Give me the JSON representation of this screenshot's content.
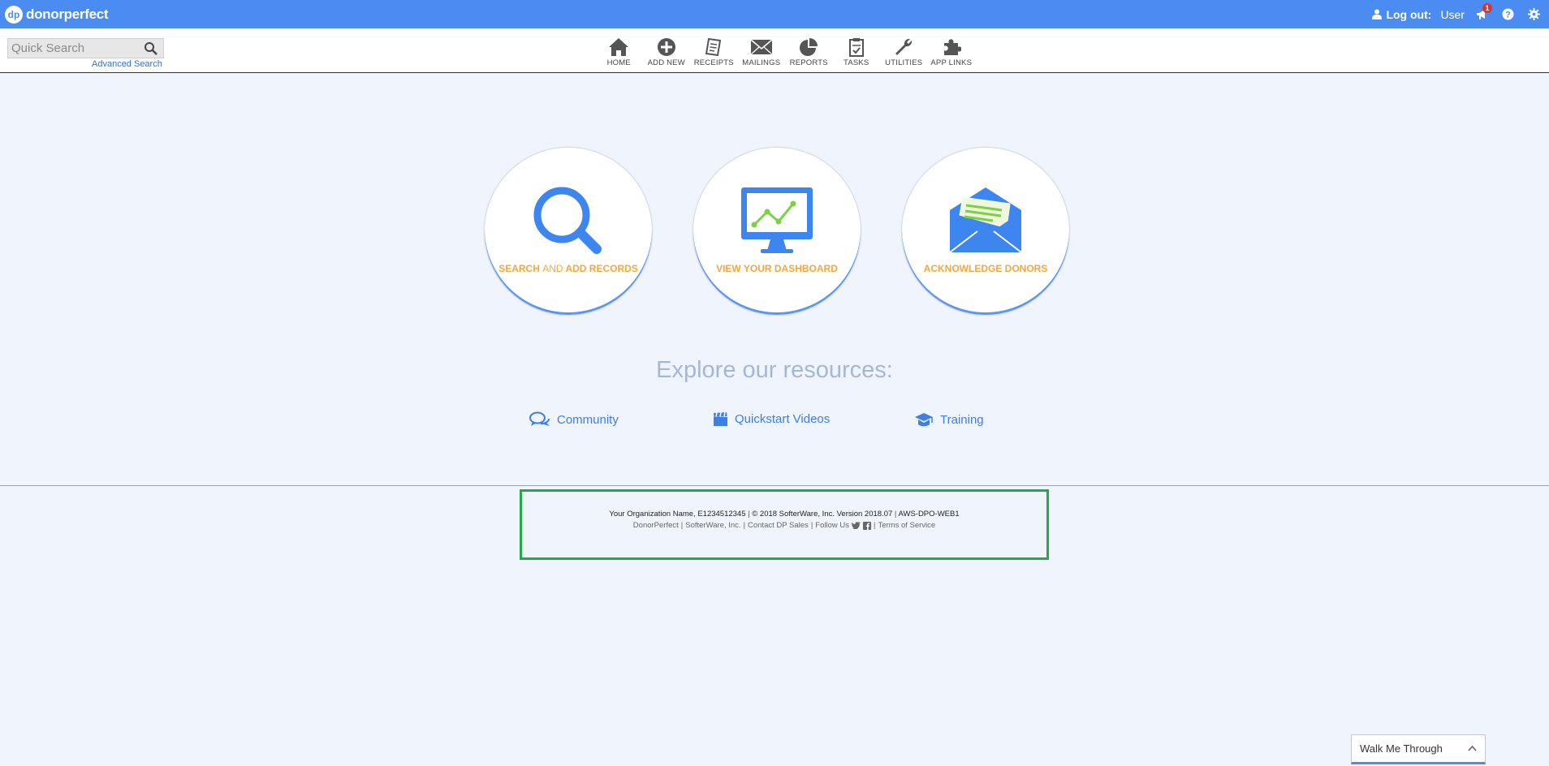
{
  "brand": {
    "badge": "dp",
    "name": "donorperfect"
  },
  "topbar": {
    "logout_label": "Log out:",
    "user": "User",
    "notification_count": "1"
  },
  "search": {
    "placeholder": "Quick Search",
    "advanced_label": "Advanced Search"
  },
  "nav": {
    "items": [
      {
        "label": "HOME",
        "icon": "home-icon"
      },
      {
        "label": "ADD NEW",
        "icon": "plus-circle-icon"
      },
      {
        "label": "RECEIPTS",
        "icon": "receipt-icon"
      },
      {
        "label": "MAILINGS",
        "icon": "envelope-icon"
      },
      {
        "label": "REPORTS",
        "icon": "pie-chart-icon"
      },
      {
        "label": "TASKS",
        "icon": "clipboard-icon"
      },
      {
        "label": "UTILITIES",
        "icon": "wrench-icon"
      },
      {
        "label": "APP LINKS",
        "icon": "puzzle-icon"
      }
    ]
  },
  "cards": {
    "search": {
      "part1": "SEARCH",
      "and": "AND",
      "part2": "ADD RECORDS",
      "icon": "magnifier-icon"
    },
    "dashboard": {
      "label": "VIEW YOUR DASHBOARD",
      "icon": "monitor-chart-icon"
    },
    "acknowledge": {
      "label": "ACKNOWLEDGE DONORS",
      "icon": "open-envelope-icon"
    }
  },
  "resources": {
    "heading": "Explore our resources:",
    "community": "Community",
    "videos": "Quickstart Videos",
    "training": "Training"
  },
  "footer": {
    "org": "Your Organization Name, E1234512345",
    "copyright": "© 2018 SofterWare, Inc. Version 2018.07",
    "server": "AWS-DPO-WEB1",
    "link1": "DonorPerfect",
    "link2": "SofterWare, Inc.",
    "link3": "Contact DP Sales",
    "follow": "Follow Us",
    "terms": "Terms of Service"
  },
  "walk": {
    "label": "Walk Me Through"
  },
  "colors": {
    "brand_blue": "#4b8cf2",
    "accent_orange": "#f5a73a",
    "footer_highlight": "#22a94a"
  }
}
